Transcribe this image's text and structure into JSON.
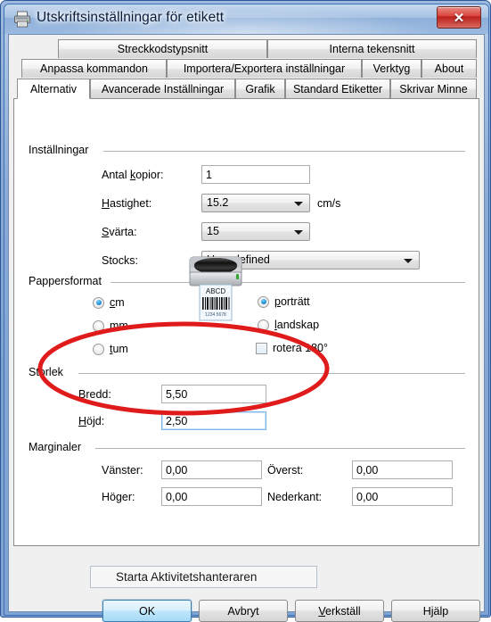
{
  "window": {
    "title": "Utskriftsinställningar för etikett",
    "icon": "printer-icon",
    "close_label": "✕",
    "accent_titlebar": "#a7c2e3",
    "accent_close": "#d9453c"
  },
  "tabs": {
    "row1": [
      {
        "label": "Streckkodstypsnitt",
        "selected": false
      },
      {
        "label": "Interna tekensnitt",
        "selected": false
      }
    ],
    "row2": [
      {
        "label": "Anpassa kommandon",
        "selected": false
      },
      {
        "label": "Importera/Exportera inställningar",
        "selected": false
      },
      {
        "label": "Verktyg",
        "selected": false
      },
      {
        "label": "About",
        "selected": false
      }
    ],
    "row3": [
      {
        "label": "Alternativ",
        "selected": true
      },
      {
        "label": "Avancerade Inställningar",
        "selected": false
      },
      {
        "label": "Grafik",
        "selected": false
      },
      {
        "label": "Standard Etiketter",
        "selected": false
      },
      {
        "label": "Skrivar Minne",
        "selected": false
      }
    ]
  },
  "groups": {
    "installningar": {
      "title": "Inställningar",
      "copies": {
        "label_pre": "Antal ",
        "label_accel": "k",
        "label_post": "opior:",
        "value": "1"
      },
      "speed": {
        "label_accel": "H",
        "label_post": "astighet:",
        "value": "15.2",
        "unit": "cm/s"
      },
      "darkness": {
        "label_accel": "S",
        "label_post": "värta:",
        "value": "15"
      },
      "stocks": {
        "label": "Stocks:",
        "value": "User defined"
      }
    },
    "pappersformat": {
      "title": "Pappersformat",
      "units": [
        {
          "label_accel": "c",
          "label_post": "m",
          "checked": true
        },
        {
          "label_accel": "m",
          "label_post": "m",
          "checked": false
        },
        {
          "label_accel": "t",
          "label_post": "um",
          "checked": false
        }
      ],
      "orientation": [
        {
          "label_pre": "",
          "label_accel": "p",
          "label_post": "orträtt",
          "checked": true
        },
        {
          "label_pre": "",
          "label_accel": "l",
          "label_post": "andskap",
          "checked": false
        }
      ],
      "rotate": {
        "label": "rotera 180°",
        "checked": false
      },
      "illustration": {
        "name": "printer-label-illustration",
        "label_text": "ABCD",
        "barcode_digits": "1234 5678"
      }
    },
    "storlek": {
      "title": "Storlek",
      "width": {
        "label_accel": "B",
        "label_post": "redd:",
        "value": "5,50"
      },
      "height": {
        "label_accel": "H",
        "label_post": "öjd:",
        "value": "2,50",
        "focused": true
      }
    },
    "marginaler": {
      "title": "Marginaler",
      "left": {
        "label": "Vänster:",
        "value": "0,00"
      },
      "right": {
        "label": "Höger:",
        "value": "0,00"
      },
      "top": {
        "label": "Överst:",
        "value": "0,00"
      },
      "bottom": {
        "label": "Nederkant:",
        "value": "0,00"
      }
    }
  },
  "buttons": {
    "ok": {
      "label": "OK",
      "default": true
    },
    "cancel": {
      "label": "Avbryt"
    },
    "apply": {
      "label_accel": "V",
      "label_post": "erkställ"
    },
    "help": {
      "label": "Hjälp"
    }
  },
  "overlay": {
    "label": "Starta Aktivitetshanteraren"
  },
  "annotation": {
    "type": "red-ellipse",
    "color": "#e01b1b",
    "targets": "Storlek Bredd / Höjd"
  }
}
